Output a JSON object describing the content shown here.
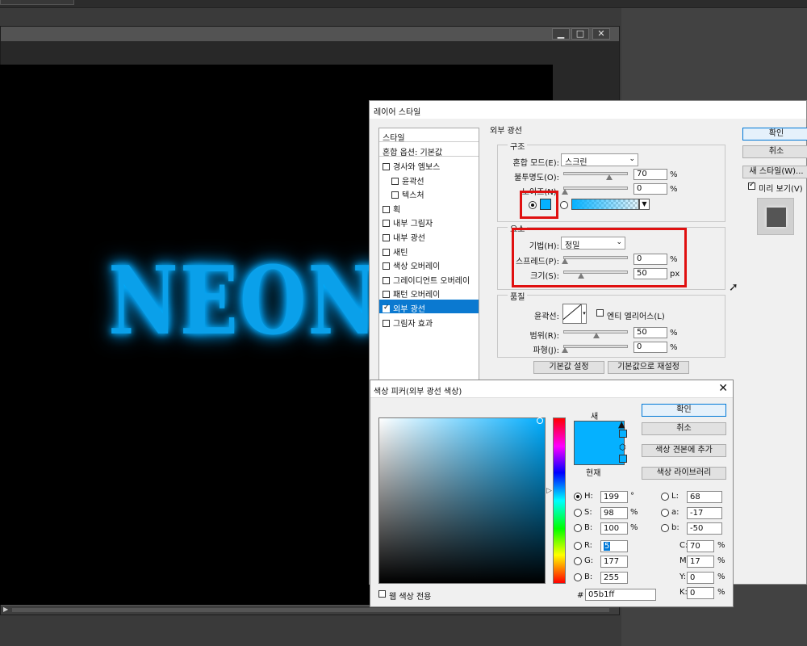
{
  "workspace": {
    "window_buttons": [
      "▁",
      "□",
      "✕"
    ],
    "canvas_text": "NEON",
    "glow_color": "#05b1ff"
  },
  "layer_style": {
    "title": "레이어 스타일",
    "styles_header": "스타일",
    "blend_options": "혼합 옵션: 기본값",
    "items": [
      {
        "label": "경사와 엠보스",
        "checked": false
      },
      {
        "label": "윤곽선",
        "checked": false,
        "indent": true
      },
      {
        "label": "텍스처",
        "checked": false,
        "indent": true
      },
      {
        "label": "획",
        "checked": false
      },
      {
        "label": "내부 그림자",
        "checked": false
      },
      {
        "label": "내부 광선",
        "checked": false
      },
      {
        "label": "새틴",
        "checked": false
      },
      {
        "label": "색상 오버레이",
        "checked": false
      },
      {
        "label": "그레이디언트 오버레이",
        "checked": false
      },
      {
        "label": "패턴 오버레이",
        "checked": false
      },
      {
        "label": "외부 광선",
        "checked": true,
        "selected": true
      },
      {
        "label": "그림자 효과",
        "checked": false
      }
    ],
    "section_title": "외부 광선",
    "structure": {
      "label": "구조",
      "blend_mode_label": "혼합 모드(E):",
      "blend_mode_value": "스크린",
      "opacity_label": "불투명도(O):",
      "opacity_value": "70",
      "noise_label": "노이즈(N):",
      "noise_value": "0",
      "unit_percent": "%"
    },
    "elements": {
      "label": "요소",
      "technique_label": "기법(H):",
      "technique_value": "정밀",
      "spread_label": "스프레드(P):",
      "spread_value": "0",
      "size_label": "크기(S):",
      "size_value": "50",
      "unit_px": "px"
    },
    "quality": {
      "label": "품질",
      "contour_label": "윤곽선:",
      "antialias_label": "엔티 엘리어스(L)",
      "range_label": "범위(R):",
      "range_value": "50",
      "jitter_label": "파형(J):",
      "jitter_value": "0"
    },
    "make_default": "기본값 설정",
    "reset_default": "기본값으로 재설정",
    "ok": "확인",
    "cancel": "취소",
    "new_style": "새 스타일(W)...",
    "preview_label": "미리 보기(V)"
  },
  "color_picker": {
    "title": "색상 피커(외부 광선 색상)",
    "new_label": "새",
    "current_label": "현재",
    "ok": "확인",
    "cancel": "취소",
    "add_to_swatches": "색상 견본에 추가",
    "color_libraries": "색상 라이브러리",
    "web_colors_only": "웹 색상 전용",
    "H": "199",
    "S": "98",
    "B": "100",
    "R": "5",
    "G": "177",
    "B2": "255",
    "L": "68",
    "a": "-17",
    "b": "-50",
    "C": "70",
    "M": "17",
    "Y": "0",
    "K": "0",
    "hex": "05b1ff",
    "label_H": "H:",
    "label_S": "S:",
    "label_B": "B:",
    "label_R": "R:",
    "label_G": "G:",
    "label_B2": "B:",
    "label_L": "L:",
    "label_a": "a:",
    "label_b": "b:",
    "label_C": "C:",
    "label_M": "M:",
    "label_Y": "Y:",
    "label_K": "K:",
    "unit_deg": "°",
    "unit_pct": "%",
    "hash": "#"
  }
}
